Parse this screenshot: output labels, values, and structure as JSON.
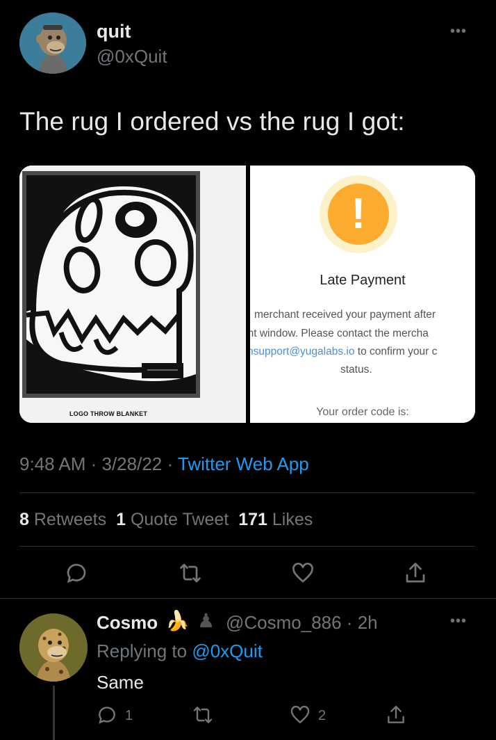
{
  "tweet": {
    "author_name": "quit",
    "author_handle": "@0xQuit",
    "more_label": "•••",
    "text": "The rug I ordered vs the rug I got:",
    "media": {
      "left_caption": "LOGO THROW BLANKET",
      "right": {
        "title": "Late Payment",
        "line1": "merchant received your payment after",
        "line2": "ent window. Please contact the mercha",
        "line3_link": "nsupport@yugalabs.io",
        "line3_rest": " to confirm your c",
        "line4": "status.",
        "order_code": "Your order code is:"
      }
    },
    "time": "9:48 AM · 3/28/22 · ",
    "source": "Twitter Web App",
    "stats": {
      "retweets_count": "8",
      "retweets_label": "Retweets",
      "quotes_count": "1",
      "quotes_label": "Quote Tweet",
      "likes_count": "171",
      "likes_label": "Likes"
    }
  },
  "reply": {
    "author_name": "Cosmo",
    "emoji_1": "🍌",
    "emoji_2": "♟",
    "author_handle": "@Cosmo_886 · 2h",
    "replying_prefix": "Replying to ",
    "replying_mention": "@0xQuit",
    "text": "Same",
    "reply_count": "1",
    "like_count": "2",
    "more_label": "•••"
  },
  "colors": {
    "background": "#000000",
    "text_primary": "#e7e9ea",
    "text_secondary": "#71767b",
    "accent": "#1d9bf0",
    "divider": "#2f3336",
    "alert_orange": "#fbac2e"
  }
}
